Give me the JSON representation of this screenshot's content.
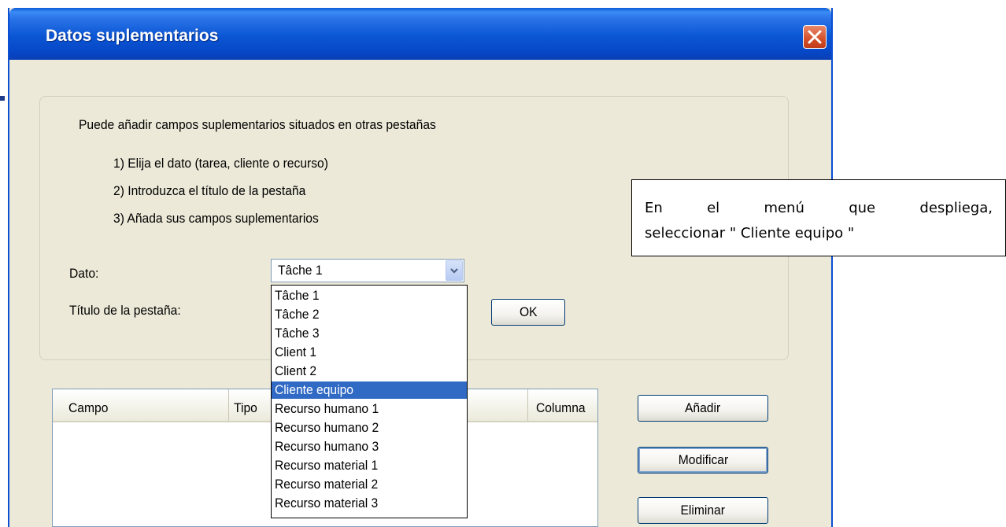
{
  "window": {
    "title": "Datos suplementarios"
  },
  "instructions": {
    "intro": "Puede añadir campos suplementarios situados en otras pestañas",
    "step1": "1) Elija el dato (tarea, cliente o recurso)",
    "step2": "2) Introduzca el título de la pestaña",
    "step3": "3) Añada sus campos suplementarios"
  },
  "form": {
    "dato_label": "Dato:",
    "titulo_label": "Título de la pestaña:",
    "dato_value": "Tâche 1",
    "ok_label": "OK"
  },
  "dropdown": {
    "items": [
      "Tâche 1",
      "Tâche 2",
      "Tâche 3",
      "Client 1",
      "Client 2",
      "Cliente equipo",
      "Recurso humano 1",
      "Recurso humano 2",
      "Recurso humano 3",
      "Recurso material 1",
      "Recurso material 2",
      "Recurso material 3"
    ],
    "selected_index": 5
  },
  "fields_table": {
    "columns": [
      "Campo",
      "Tipo",
      "Columna"
    ]
  },
  "actions": {
    "add_label": "Añadir",
    "modify_label": "Modificar",
    "delete_label": "Eliminar"
  },
  "callout": {
    "words_line1": [
      "En",
      "el",
      "menú",
      "que",
      "despliega,"
    ],
    "line2": "seleccionar \" Cliente equipo \""
  },
  "colors": {
    "titlebar": "#0b56d4",
    "dialog_bg": "#ece9d8",
    "selection": "#316ac5",
    "close_button": "#d4502a"
  }
}
